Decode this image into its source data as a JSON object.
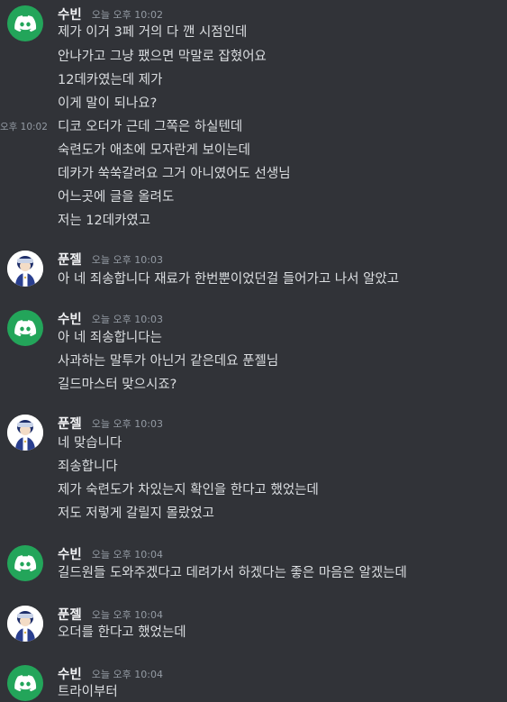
{
  "colors": {
    "background": "#313338",
    "discord_green": "#23a55a",
    "username": "#f2f3f5",
    "timestamp": "#949ba4",
    "text": "#dbdee1"
  },
  "messages": [
    {
      "author": "수빈",
      "avatar": "discord-logo-icon",
      "time": "오늘 오후 10:02",
      "hover_time": "오후 10:02",
      "lines": [
        "제가 이거 3페 거의 다 깬 시점인데",
        "안나가고 그냥 팼으면 막말로 잡혔어요",
        "12데카였는데 제가",
        "이게 말이 되나요?",
        "디코 오더가 근데 그쪽은 하실텐데",
        "숙련도가 애초에 모자란게 보이는데",
        "데카가 쑥쑥갈려요 그거 아니였어도 선생님",
        "어느곳에 글을 올려도",
        "저는 12데카였고"
      ]
    },
    {
      "author": "푼젤",
      "avatar": "character-portrait-icon",
      "time": "오늘 오후 10:03",
      "lines": [
        "아 네 죄송합니다 재료가 한번뿐이었던걸 들어가고 나서 알았고"
      ]
    },
    {
      "author": "수빈",
      "avatar": "discord-logo-icon",
      "time": "오늘 오후 10:03",
      "lines": [
        "아 네 죄송합니다는",
        "사과하는 말투가 아닌거 같은데요 푼젤님",
        "길드마스터 맞으시죠?"
      ]
    },
    {
      "author": "푼젤",
      "avatar": "character-portrait-icon",
      "time": "오늘 오후 10:03",
      "lines": [
        "네 맞습니다",
        "죄송합니다",
        "제가 숙련도가 차있는지 확인을 한다고 했었는데",
        "저도 저렇게 갈릴지 몰랐었고"
      ]
    },
    {
      "author": "수빈",
      "avatar": "discord-logo-icon",
      "time": "오늘 오후 10:04",
      "lines": [
        "길드원들 도와주겠다고 데려가서 하겠다는 좋은 마음은 알겠는데"
      ]
    },
    {
      "author": "푼젤",
      "avatar": "character-portrait-icon",
      "time": "오늘 오후 10:04",
      "lines": [
        "오더를 한다고 했었는데"
      ]
    },
    {
      "author": "수빈",
      "avatar": "discord-logo-icon",
      "time": "오늘 오후 10:04",
      "lines": [
        "트라이부터"
      ]
    }
  ]
}
